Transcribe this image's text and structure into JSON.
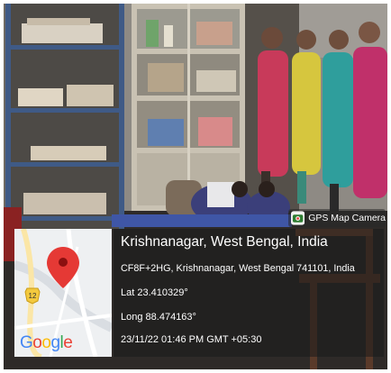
{
  "badge": {
    "label": "GPS Map Camera",
    "icon": "map-camera-icon"
  },
  "map": {
    "road_label": "12",
    "logo_letters": [
      "G",
      "o",
      "o",
      "g",
      "l",
      "e"
    ],
    "logo_colors": [
      "#4285F4",
      "#EA4335",
      "#FBBC05",
      "#4285F4",
      "#34A853",
      "#EA4335"
    ],
    "pin_color": "#E53935",
    "icon": "location-pin-icon"
  },
  "info": {
    "title": "Krishnanagar, West Bengal, India",
    "address": "CF8F+2HG, Krishnanagar, West Bengal 741101, India",
    "lat_label": "Lat",
    "lat_value": "23.410329°",
    "long_label": "Long",
    "long_value": "88.474163°",
    "datetime": "23/11/22 01:46 PM GMT +05:30"
  }
}
